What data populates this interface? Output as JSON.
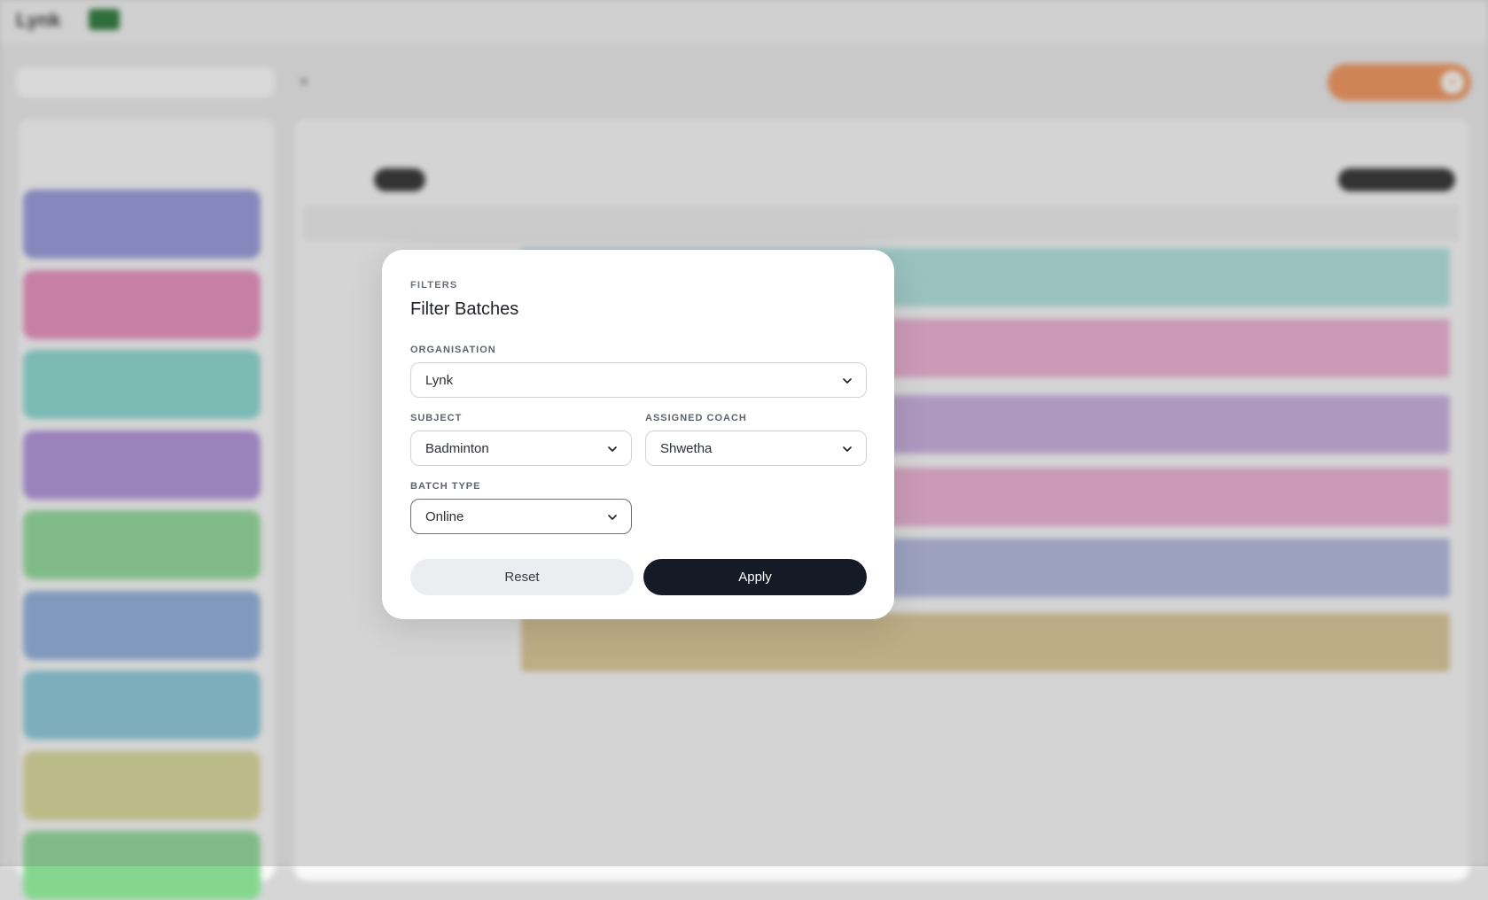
{
  "modal": {
    "overline": "FILTERS",
    "title": "Filter Batches",
    "organisation": {
      "label": "ORGANISATION",
      "value": "Lynk"
    },
    "subject": {
      "label": "SUBJECT",
      "value": "Badminton"
    },
    "coach": {
      "label": "ASSIGNED COACH",
      "value": "Shwetha"
    },
    "batch_type": {
      "label": "BATCH TYPE",
      "value": "Online"
    },
    "reset_label": "Reset",
    "apply_label": "Apply"
  },
  "colors": {
    "apply_bg": "#141a26",
    "reset_bg": "#ebedf0",
    "create_button": "#f08a4a"
  }
}
